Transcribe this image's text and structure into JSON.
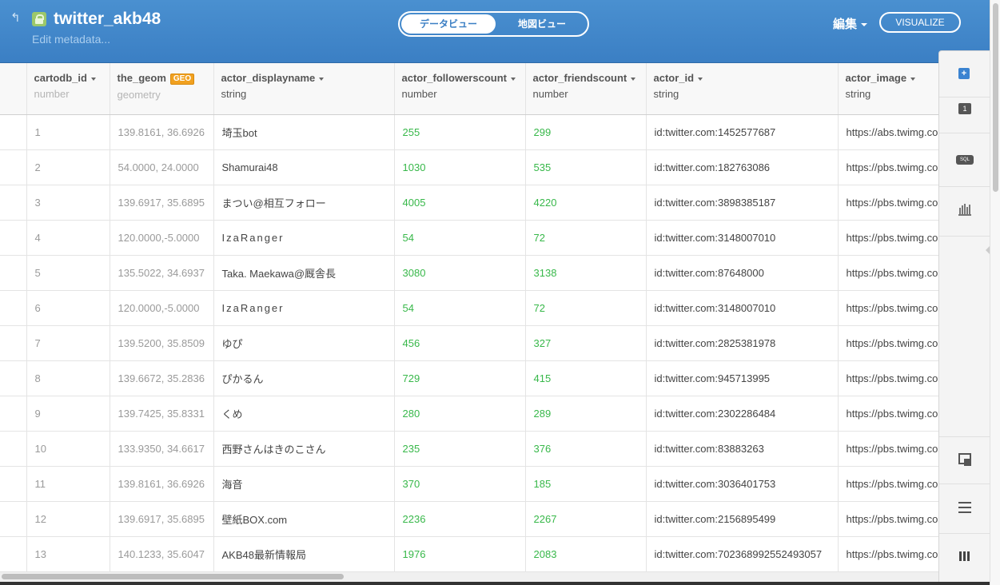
{
  "header": {
    "title": "twitter_akb48",
    "edit_metadata": "Edit metadata...",
    "view_toggle": {
      "data_view": "データビュー",
      "map_view": "地図ビュー",
      "active": "data_view"
    },
    "edit_menu": "編集",
    "visualize_label": "VISUALIZE"
  },
  "table": {
    "columns": [
      {
        "name": "cartodb_id",
        "type": "number",
        "has_caret": true
      },
      {
        "name": "the_geom",
        "type": "geometry",
        "badge": "GEO"
      },
      {
        "name": "actor_displayname",
        "type": "string",
        "has_caret": true
      },
      {
        "name": "actor_followerscount",
        "type": "number",
        "has_caret": true
      },
      {
        "name": "actor_friendscount",
        "type": "number",
        "has_caret": true
      },
      {
        "name": "actor_id",
        "type": "string",
        "has_caret": true
      },
      {
        "name": "actor_image",
        "type": "string",
        "has_caret": true
      }
    ],
    "rows": [
      [
        "1",
        "139.8161, 36.6926",
        "埼玉bot",
        "255",
        "299",
        "id:twitter.com:1452577687",
        "https://abs.twimg.co"
      ],
      [
        "2",
        "54.0000, 24.0000",
        "Shamurai48",
        "1030",
        "535",
        "id:twitter.com:182763086",
        "https://pbs.twimg.co"
      ],
      [
        "3",
        "139.6917, 35.6895",
        "まつい@相互フォロー",
        "4005",
        "4220",
        "id:twitter.com:3898385187",
        "https://pbs.twimg.co"
      ],
      [
        "4",
        "120.0000,-5.0000",
        "IzaRanger",
        "54",
        "72",
        "id:twitter.com:3148007010",
        "https://pbs.twimg.co"
      ],
      [
        "5",
        "135.5022, 34.6937",
        "Taka. Maekawa@厩舎長",
        "3080",
        "3138",
        "id:twitter.com:87648000",
        "https://pbs.twimg.co"
      ],
      [
        "6",
        "120.0000,-5.0000",
        "IzaRanger",
        "54",
        "72",
        "id:twitter.com:3148007010",
        "https://pbs.twimg.co"
      ],
      [
        "7",
        "139.5200, 35.8509",
        "ゆぴ",
        "456",
        "327",
        "id:twitter.com:2825381978",
        "https://pbs.twimg.co"
      ],
      [
        "8",
        "139.6672, 35.2836",
        "ぴかるん",
        "729",
        "415",
        "id:twitter.com:945713995",
        "https://pbs.twimg.co"
      ],
      [
        "9",
        "139.7425, 35.8331",
        "くめ",
        "280",
        "289",
        "id:twitter.com:2302286484",
        "https://pbs.twimg.co"
      ],
      [
        "10",
        "133.9350, 34.6617",
        "西野さんはきのこさん",
        "235",
        "376",
        "id:twitter.com:83883263",
        "https://pbs.twimg.co"
      ],
      [
        "11",
        "139.8161, 36.6926",
        "海音",
        "370",
        "185",
        "id:twitter.com:3036401753",
        "https://pbs.twimg.co"
      ],
      [
        "12",
        "139.6917, 35.6895",
        "壁紙BOX.com",
        "2236",
        "2267",
        "id:twitter.com:2156895499",
        "https://pbs.twimg.co"
      ],
      [
        "13",
        "140.1233, 35.6047",
        "AKB48最新情報局",
        "1976",
        "2083",
        "id:twitter.com:702368992552493057",
        "https://pbs.twimg.co"
      ]
    ]
  },
  "rail": {
    "items": [
      "add-column-icon",
      "filter-icon",
      "sql-icon",
      "chart-icon",
      "merge-icon",
      "add-row-icon",
      "add-column-icon"
    ]
  },
  "colors": {
    "header": "#3b7fc4",
    "numeric": "#38b84a",
    "geo_badge": "#f1a120"
  }
}
